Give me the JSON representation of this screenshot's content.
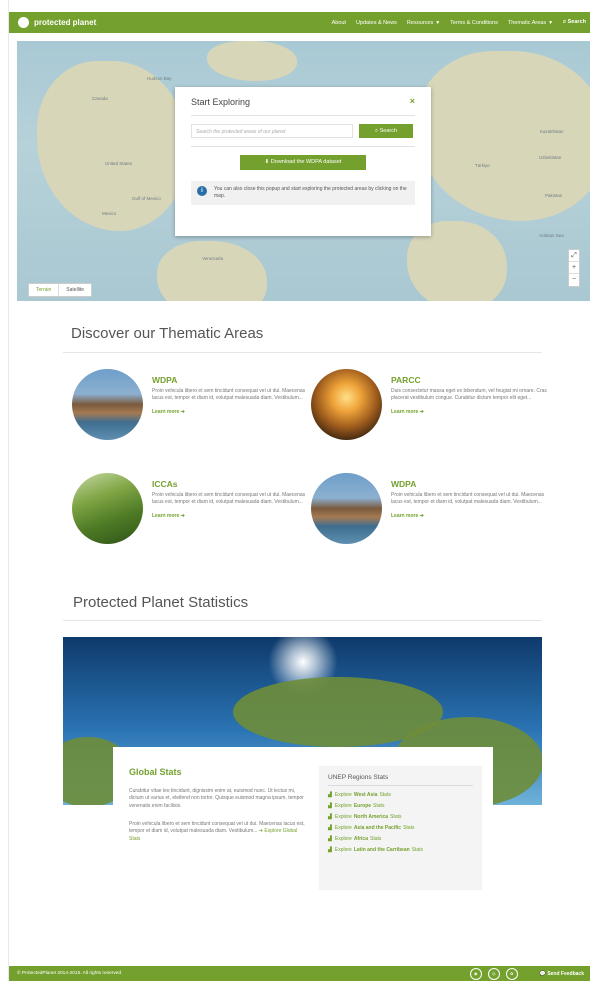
{
  "nav": {
    "logo_text": "protected planet",
    "links": [
      {
        "label": "About"
      },
      {
        "label": "Updates & News"
      },
      {
        "label": "Resources",
        "dropdown": true
      },
      {
        "label": "Terms & Conditions"
      },
      {
        "label": "Thematic Areas",
        "dropdown": true
      },
      {
        "label": "Search",
        "icon": "search-icon"
      }
    ]
  },
  "map": {
    "labels": [
      "Canada",
      "United States",
      "Mexico",
      "Gulf of Mexico",
      "Hudson Bay",
      "Venezuela",
      "Türkiye",
      "Kazakhstan",
      "Uzbekistan",
      "Pakistan",
      "Arabian Sea"
    ],
    "tabs": [
      {
        "label": "Terrain",
        "active": true
      },
      {
        "label": "Satellite",
        "active": false
      }
    ],
    "zoom": {
      "in": "+",
      "out": "−"
    }
  },
  "popup": {
    "title": "Start Exploring",
    "close": "×",
    "search_placeholder": "Search the protected areas of our planet",
    "search_button": "Search",
    "download_button": "Download the WDPA dataset",
    "info_text": "You can also close this popup and start exploring the protected areas by clicking on the map."
  },
  "thematic": {
    "title": "Discover our Thematic Areas",
    "cards": [
      {
        "title": "WDPA",
        "text": "Proin vehicula libero et sem tincidunt consequat vel ut dui. Maecenas lacus est, tempor et diam id, volutpat malesuada diam. Vestibulum...",
        "link": "Learn more"
      },
      {
        "title": "PARCC",
        "text": "Duis consectetur massa eget ex bibendum, vel feugiat mi ornare. Cras placerat vestibulum congue. Curabitur dictum tempor elit eget...",
        "link": "Learn more"
      },
      {
        "title": "ICCAs",
        "text": "Proin vehicula libero et sem tincidunt consequat vel ut dui. Maecenas lacus est, tempor et diam id, volutpat malesuada diam. Vestibulum...",
        "link": "Learn more"
      },
      {
        "title": "WDPA",
        "text": "Proin vehicula libero et sem tincidunt consequat vel ut dui. Maecenas lacus est, tempor et diam id, volutpat malesuada diam. Vestibulum...",
        "link": "Learn more"
      }
    ]
  },
  "stats": {
    "title": "Protected Planet Statistics",
    "global_title": "Global Stats",
    "global_text_1": "Curabitur vitae leo tincidunt, dignissim enim at, euismod nunc. Ut lectus mi, dictum ut varius et, eleifend non tortor. Quisque euismod magna ipsum, tempor venenatis enim facilisis.",
    "global_text_2": "Proin vehicula libero et sem tincidunt consequat vel ut dui. Maecenas lacus est, tempor et diam id, volutpat malesuada diam. Vestibulum...",
    "global_link": "Explore Global Stats",
    "regions_title": "UNEP Regions Stats",
    "regions": [
      {
        "prefix": "Explore",
        "name": "West Asia",
        "suffix": "Stats"
      },
      {
        "prefix": "Explore",
        "name": "Europe",
        "suffix": "Stats"
      },
      {
        "prefix": "Explore",
        "name": "North America",
        "suffix": "Stats"
      },
      {
        "prefix": "Explore",
        "name": "Asia and the Pacific",
        "suffix": "Stats"
      },
      {
        "prefix": "Explore",
        "name": "Africa",
        "suffix": "Stats"
      },
      {
        "prefix": "Explore",
        "name": "Latin and the Carribean",
        "suffix": "Stats"
      }
    ]
  },
  "footer": {
    "copyright": "© ProtectedPlanet 2014-2015. All rights reserved",
    "feedback": "Send Feedback"
  },
  "colors": {
    "brand": "#74a12e",
    "info": "#2a6fa8"
  }
}
